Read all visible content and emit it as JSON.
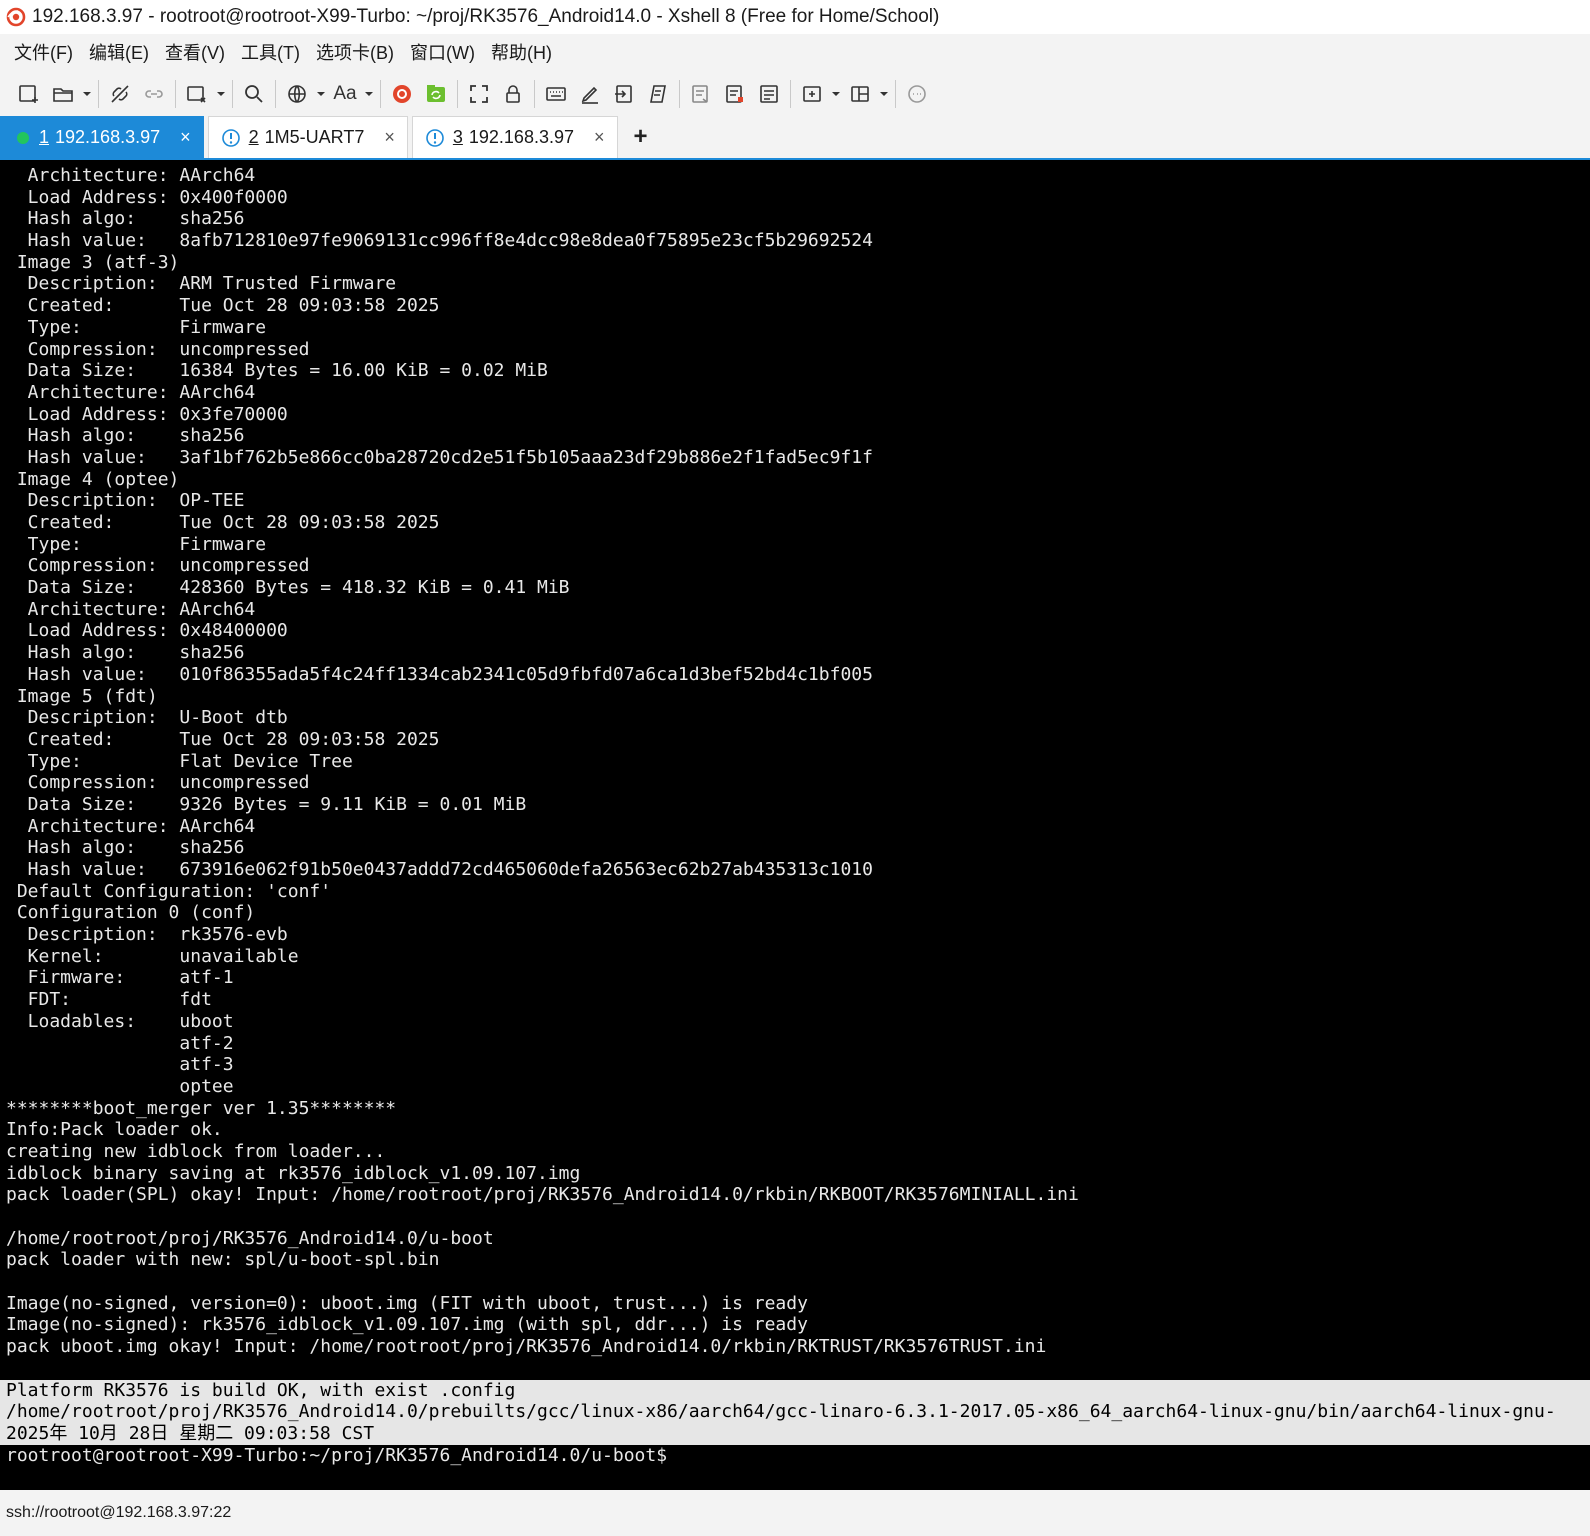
{
  "window": {
    "title": "192.168.3.97 - rootroot@rootroot-X99-Turbo: ~/proj/RK3576_Android14.0 - Xshell 8 (Free for Home/School)",
    "logo_icon": "xshell-logo-icon"
  },
  "menu": [
    {
      "label": "文件(F)"
    },
    {
      "label": "编辑(E)"
    },
    {
      "label": "查看(V)"
    },
    {
      "label": "工具(T)"
    },
    {
      "label": "选项卡(B)"
    },
    {
      "label": "窗口(W)"
    },
    {
      "label": "帮助(H)"
    }
  ],
  "toolbar": {
    "font_label": "Aa",
    "icons": [
      "new-session-icon",
      "open-folder-icon",
      "disconnect-icon",
      "reconnect-icon",
      "new-window-icon",
      "find-icon",
      "globe-icon",
      "font-icon",
      "xftp-icon",
      "xmanager-icon",
      "fullscreen-icon",
      "lock-icon",
      "keyboard-icon",
      "compose-icon",
      "transfer-icon",
      "script-icon",
      "log-icon",
      "record-icon",
      "notes-icon",
      "add-pane-icon",
      "layout-icon",
      "chat-icon"
    ]
  },
  "tabs": [
    {
      "num": "1",
      "label": "192.168.3.97",
      "status": "connected",
      "close": "×"
    },
    {
      "num": "2",
      "label": "1M5-UART7",
      "status": "warning",
      "close": "×"
    },
    {
      "num": "3",
      "label": "192.168.3.97",
      "status": "warning",
      "close": "×"
    }
  ],
  "tab_add": "+",
  "terminal": {
    "lines": [
      "  Architecture: AArch64",
      "  Load Address: 0x400f0000",
      "  Hash algo:    sha256",
      "  Hash value:   8afb712810e97fe9069131cc996ff8e4dcc98e8dea0f75895e23cf5b29692524",
      " Image 3 (atf-3)",
      "  Description:  ARM Trusted Firmware",
      "  Created:      Tue Oct 28 09:03:58 2025",
      "  Type:         Firmware",
      "  Compression:  uncompressed",
      "  Data Size:    16384 Bytes = 16.00 KiB = 0.02 MiB",
      "  Architecture: AArch64",
      "  Load Address: 0x3fe70000",
      "  Hash algo:    sha256",
      "  Hash value:   3af1bf762b5e866cc0ba28720cd2e51f5b105aaa23df29b886e2f1fad5ec9f1f",
      " Image 4 (optee)",
      "  Description:  OP-TEE",
      "  Created:      Tue Oct 28 09:03:58 2025",
      "  Type:         Firmware",
      "  Compression:  uncompressed",
      "  Data Size:    428360 Bytes = 418.32 KiB = 0.41 MiB",
      "  Architecture: AArch64",
      "  Load Address: 0x48400000",
      "  Hash algo:    sha256",
      "  Hash value:   010f86355ada5f4c24ff1334cab2341c05d9fbfd07a6ca1d3bef52bd4c1bf005",
      " Image 5 (fdt)",
      "  Description:  U-Boot dtb",
      "  Created:      Tue Oct 28 09:03:58 2025",
      "  Type:         Flat Device Tree",
      "  Compression:  uncompressed",
      "  Data Size:    9326 Bytes = 9.11 KiB = 0.01 MiB",
      "  Architecture: AArch64",
      "  Hash algo:    sha256",
      "  Hash value:   673916e062f91b50e0437addd72cd465060defa26563ec62b27ab435313c1010",
      " Default Configuration: 'conf'",
      " Configuration 0 (conf)",
      "  Description:  rk3576-evb",
      "  Kernel:       unavailable",
      "  Firmware:     atf-1",
      "  FDT:          fdt",
      "  Loadables:    uboot",
      "                atf-2",
      "                atf-3",
      "                optee",
      "********boot_merger ver 1.35********",
      "Info:Pack loader ok.",
      "creating new idblock from loader...",
      "idblock binary saving at rk3576_idblock_v1.09.107.img",
      "pack loader(SPL) okay! Input: /home/rootroot/proj/RK3576_Android14.0/rkbin/RKBOOT/RK3576MINIALL.ini",
      "",
      "/home/rootroot/proj/RK3576_Android14.0/u-boot",
      "pack loader with new: spl/u-boot-spl.bin",
      "",
      "Image(no-signed, version=0): uboot.img (FIT with uboot, trust...) is ready",
      "Image(no-signed): rk3576_idblock_v1.09.107.img (with spl, ddr...) is ready",
      "pack uboot.img okay! Input: /home/rootroot/proj/RK3576_Android14.0/rkbin/RKTRUST/RK3576TRUST.ini",
      "",
      "Platform RK3576 is build OK, with exist .config",
      "/home/rootroot/proj/RK3576_Android14.0/prebuilts/gcc/linux-x86/aarch64/gcc-linaro-6.3.1-2017.05-x86_64_aarch64-linux-gnu/bin/aarch64-linux-gnu-",
      "2025年 10月 28日 星期二 09:03:58 CST",
      "rootroot@rootroot-X99-Turbo:~/proj/RK3576_Android14.0/u-boot$"
    ]
  },
  "status": {
    "connection": "ssh://rootroot@192.168.3.97:22"
  },
  "colors": {
    "accent": "#1d8ad8",
    "terminal_bg": "#000000",
    "terminal_fg": "#e8e8e8",
    "highlight_bg": "#e6e6e6",
    "connected": "#22c55e",
    "warning": "#1d8ad8"
  }
}
